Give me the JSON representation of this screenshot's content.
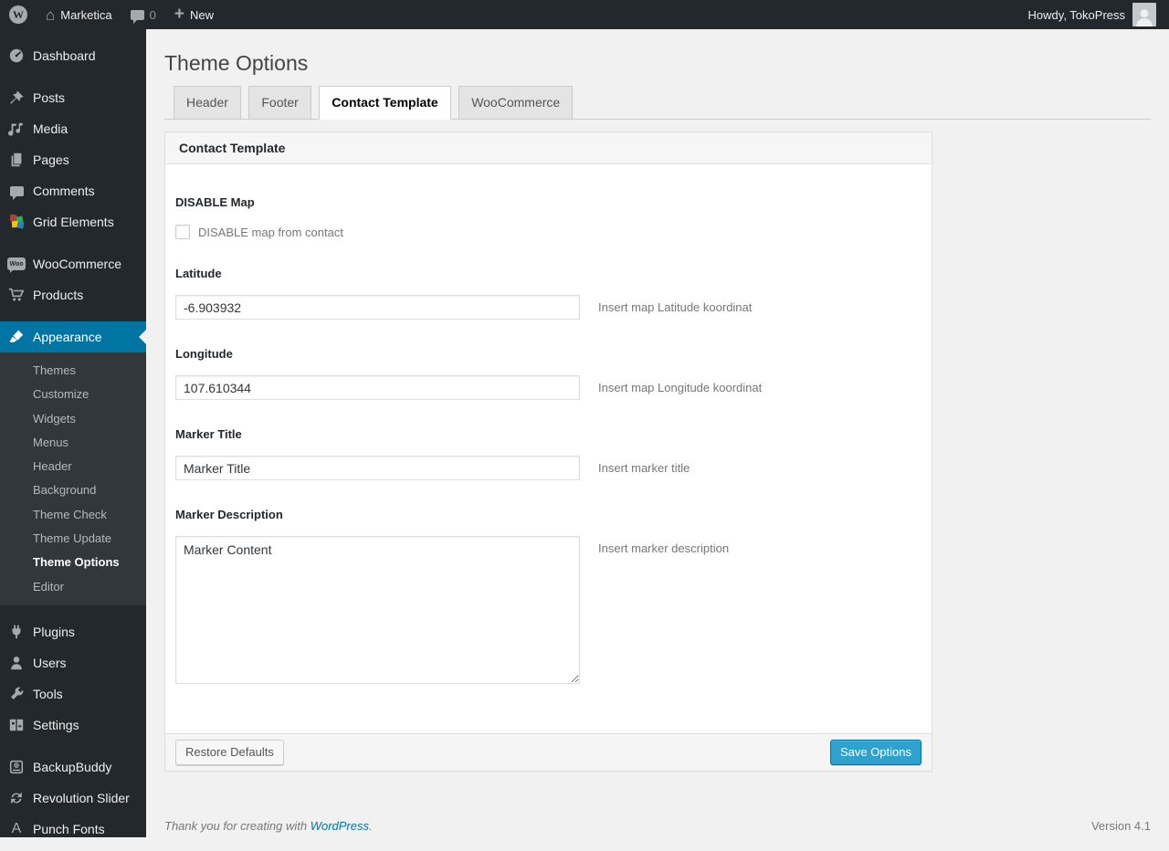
{
  "admin_bar": {
    "site_name": "Marketica",
    "comment_count": "0",
    "new_label": "New",
    "howdy_text": "Howdy, TokoPress"
  },
  "sidebar": {
    "items": [
      {
        "label": "Dashboard",
        "icon": "dashboard-gauge-icon"
      },
      {
        "label": "Posts",
        "icon": "pushpin-icon"
      },
      {
        "label": "Media",
        "icon": "media-icon"
      },
      {
        "label": "Pages",
        "icon": "pages-icon"
      },
      {
        "label": "Comments",
        "icon": "comment-bubble-icon"
      },
      {
        "label": "Grid Elements",
        "icon": "grid-elements-icon"
      },
      {
        "label": "WooCommerce",
        "icon": "woo-badge-icon"
      },
      {
        "label": "Products",
        "icon": "cart-icon"
      },
      {
        "label": "Appearance",
        "icon": "paintbrush-icon",
        "active": true
      },
      {
        "label": "Plugins",
        "icon": "plug-icon"
      },
      {
        "label": "Users",
        "icon": "person-icon"
      },
      {
        "label": "Tools",
        "icon": "wrench-icon"
      },
      {
        "label": "Settings",
        "icon": "settings-icon"
      },
      {
        "label": "BackupBuddy",
        "icon": "backup-box-icon"
      },
      {
        "label": "Revolution Slider",
        "icon": "refresh-arrows-icon"
      },
      {
        "label": "Punch Fonts",
        "icon": "letter-a-icon"
      }
    ],
    "appearance_submenu": [
      "Themes",
      "Customize",
      "Widgets",
      "Menus",
      "Header",
      "Background",
      "Theme Check",
      "Theme Update",
      "Theme Options",
      "Editor"
    ],
    "current_submenu_item": "Theme Options"
  },
  "page": {
    "title": "Theme Options",
    "tabs": [
      {
        "label": "Header",
        "active": false
      },
      {
        "label": "Footer",
        "active": false
      },
      {
        "label": "Contact Template",
        "active": true
      },
      {
        "label": "WooCommerce",
        "active": false
      }
    ],
    "panel": {
      "title": "Contact Template",
      "disable_map": {
        "label": "DISABLE Map",
        "checkbox_label": "DISABLE map from contact",
        "checked": false
      },
      "latitude": {
        "label": "Latitude",
        "value": "-6.903932",
        "help": "Insert map Latitude koordinat"
      },
      "longitude": {
        "label": "Longitude",
        "value": "107.610344",
        "help": "Insert map Longitude koordinat"
      },
      "marker_title": {
        "label": "Marker Title",
        "value": "Marker Title",
        "help": "Insert marker title"
      },
      "marker_description": {
        "label": "Marker Description",
        "value": "Marker Content",
        "help": "Insert marker description"
      },
      "restore_button": "Restore Defaults",
      "save_button": "Save Options"
    },
    "footer": {
      "thanks_text": "Thank you for creating with",
      "link_label": "WordPress",
      "period": ".",
      "version": "Version 4.1"
    }
  },
  "colors": {
    "accent_blue": "#0074a2",
    "primary_button": "#2ea2cc",
    "admin_bar_bg": "#23282d",
    "sidebar_bg": "#23282d",
    "submenu_bg": "#32373c",
    "content_bg": "#f1f1f1",
    "link_blue": "#0074a2"
  }
}
